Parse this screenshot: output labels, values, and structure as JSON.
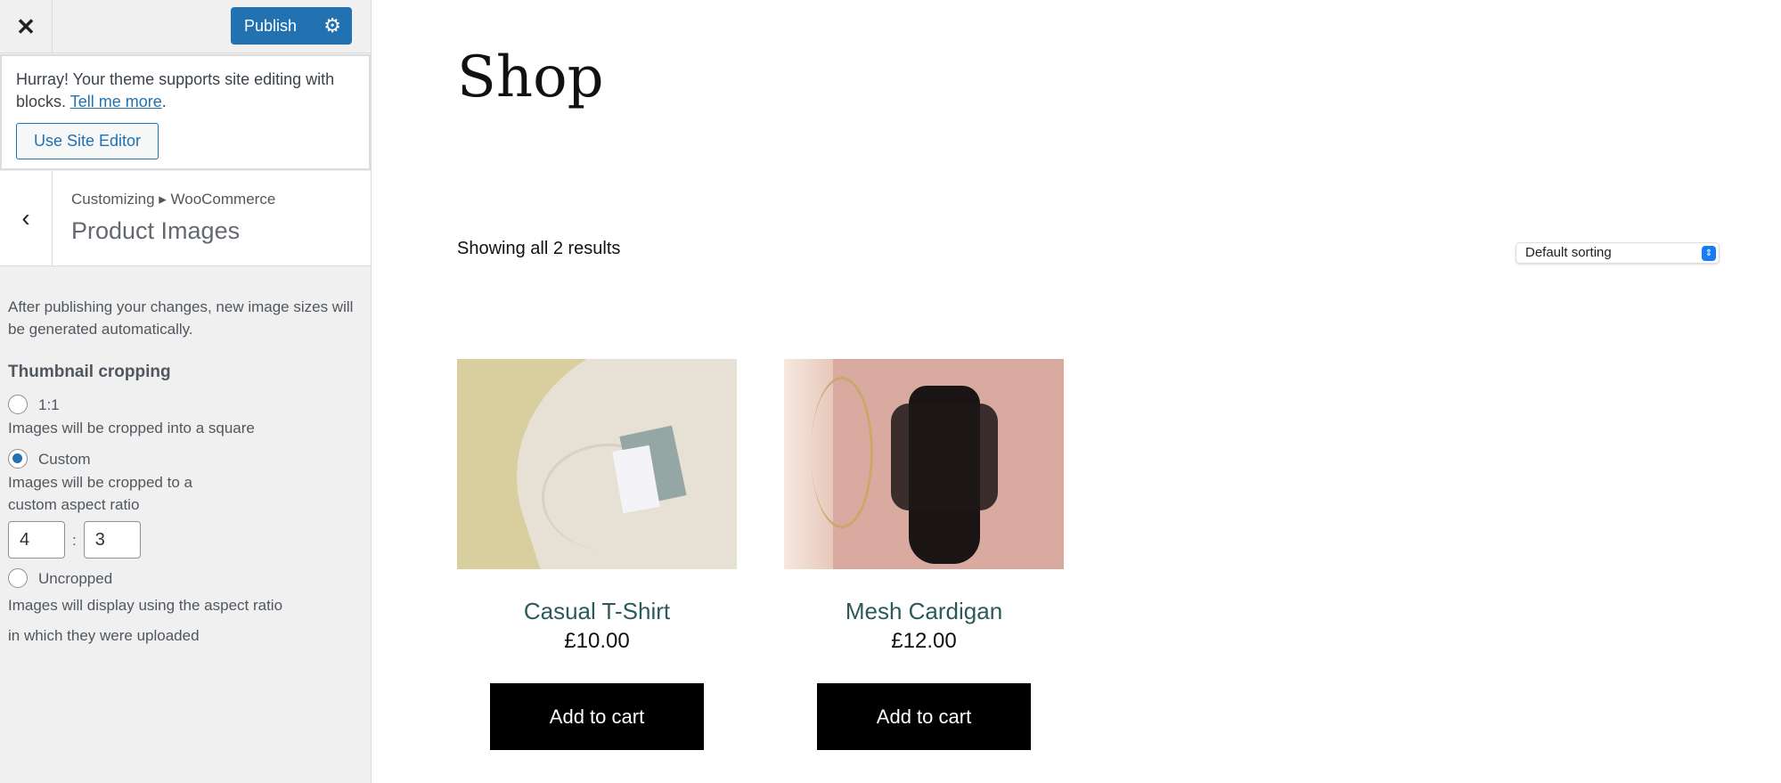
{
  "sidebar": {
    "close_icon": "close-icon",
    "publish_label": "Publish",
    "notice": {
      "text": "Hurray! Your theme supports site editing with blocks.",
      "link": "Tell me more",
      "period": ".",
      "button": "Use Site Editor"
    },
    "breadcrumb": "Customizing ▸ WooCommerce",
    "section_title": "Product Images",
    "description": "After publishing your changes, new image sizes will be generated automatically.",
    "cropping_heading": "Thumbnail cropping",
    "options": [
      {
        "label": "1:1",
        "desc": "Images will be cropped into a square",
        "selected": false
      },
      {
        "label": "Custom",
        "desc": "Images will be cropped to a custom aspect ratio",
        "selected": true
      },
      {
        "label": "Uncropped",
        "desc": "Images will display using the aspect ratio in which they were uploaded",
        "selected": false
      }
    ],
    "ratio_width": "4",
    "ratio_sep": ":",
    "ratio_height": "3"
  },
  "main": {
    "title": "Shop",
    "result_count": "Showing all 2 results",
    "sorting": "Default sorting",
    "products": [
      {
        "name": "Casual T-Shirt",
        "price": "£10.00",
        "button": "Add to cart"
      },
      {
        "name": "Mesh Cardigan",
        "price": "£12.00",
        "button": "Add to cart"
      }
    ]
  },
  "colors": {
    "accent": "#2271b1",
    "button": "#000000",
    "product_name": "#2b5a5a"
  }
}
